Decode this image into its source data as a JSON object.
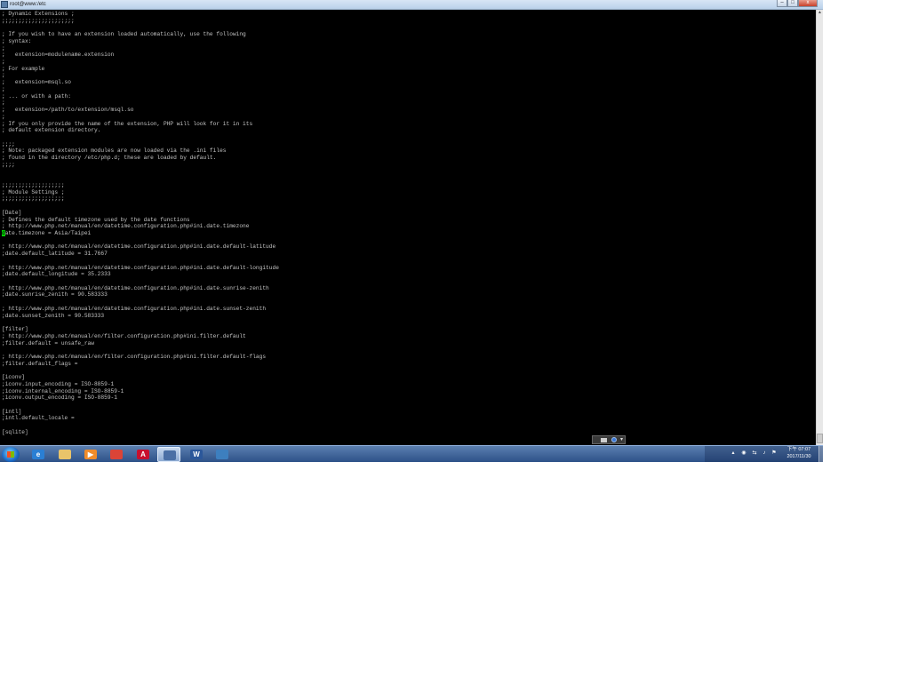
{
  "window": {
    "title": "root@www:/etc"
  },
  "terminal": {
    "lines": [
      "; Dynamic Extensions ;",
      ";;;;;;;;;;;;;;;;;;;;;;",
      "",
      "; If you wish to have an extension loaded automatically, use the following",
      "; syntax:",
      ";",
      ";   extension=modulename.extension",
      ";",
      "; For example",
      ";",
      ";   extension=msql.so",
      ";",
      "; ... or with a path:",
      ";",
      ";   extension=/path/to/extension/msql.so",
      ";",
      "; If you only provide the name of the extension, PHP will look for it in its",
      "; default extension directory.",
      "",
      ";;;;",
      "; Note: packaged extension modules are now loaded via the .ini files",
      "; found in the directory /etc/php.d; these are loaded by default.",
      ";;;;",
      "",
      "",
      ";;;;;;;;;;;;;;;;;;;",
      "; Module Settings ;",
      ";;;;;;;;;;;;;;;;;;;",
      "",
      "[Date]",
      "; Defines the default timezone used by the date functions",
      "; http://www.php.net/manual/en/datetime.configuration.php#ini.date.timezone",
      "date.timezone = Asia/Taipei",
      "",
      "; http://www.php.net/manual/en/datetime.configuration.php#ini.date.default-latitude",
      ";date.default_latitude = 31.7667",
      "",
      "; http://www.php.net/manual/en/datetime.configuration.php#ini.date.default-longitude",
      ";date.default_longitude = 35.2333",
      "",
      "; http://www.php.net/manual/en/datetime.configuration.php#ini.date.sunrise-zenith",
      ";date.sunrise_zenith = 90.583333",
      "",
      "; http://www.php.net/manual/en/datetime.configuration.php#ini.date.sunset-zenith",
      ";date.sunset_zenith = 90.583333",
      "",
      "[filter]",
      "; http://www.php.net/manual/en/filter.configuration.php#ini.filter.default",
      ";filter.default = unsafe_raw",
      "",
      "; http://www.php.net/manual/en/filter.configuration.php#ini.filter.default-flags",
      ";filter.default_flags =",
      "",
      "[iconv]",
      ";iconv.input_encoding = ISO-8859-1",
      ";iconv.internal_encoding = ISO-8859-1",
      ";iconv.output_encoding = ISO-8859-1",
      "",
      "[intl]",
      ";intl.default_locale =",
      "",
      "[sqlite]"
    ],
    "cursor_line": 32,
    "text_color": "#c4c4c4",
    "cursor_color": "#00d000",
    "background": "#000000"
  },
  "taskbar": {
    "start_icon": "windows-start-orb",
    "apps": [
      {
        "icon": "internet-explorer-icon",
        "color": "#2a7fd4",
        "glyph": "e"
      },
      {
        "icon": "file-explorer-icon",
        "color": "#e9c46a",
        "glyph": ""
      },
      {
        "icon": "media-player-icon",
        "color": "#f08c2a",
        "glyph": "▶"
      },
      {
        "icon": "chrome-icon",
        "color": "#db4437",
        "glyph": ""
      },
      {
        "icon": "acrobat-reader-icon",
        "color": "#c8102e",
        "glyph": "A"
      },
      {
        "icon": "putty-icon",
        "color": "#4a6fa5",
        "glyph": ""
      },
      {
        "icon": "word-icon",
        "color": "#2b579a",
        "glyph": "W"
      },
      {
        "icon": "remote-desktop-icon",
        "color": "#3d7fbf",
        "glyph": ""
      }
    ],
    "active_apps": [
      5
    ],
    "tray": {
      "clock_time": "下午 07:07",
      "clock_date": "2017/11/30"
    }
  }
}
